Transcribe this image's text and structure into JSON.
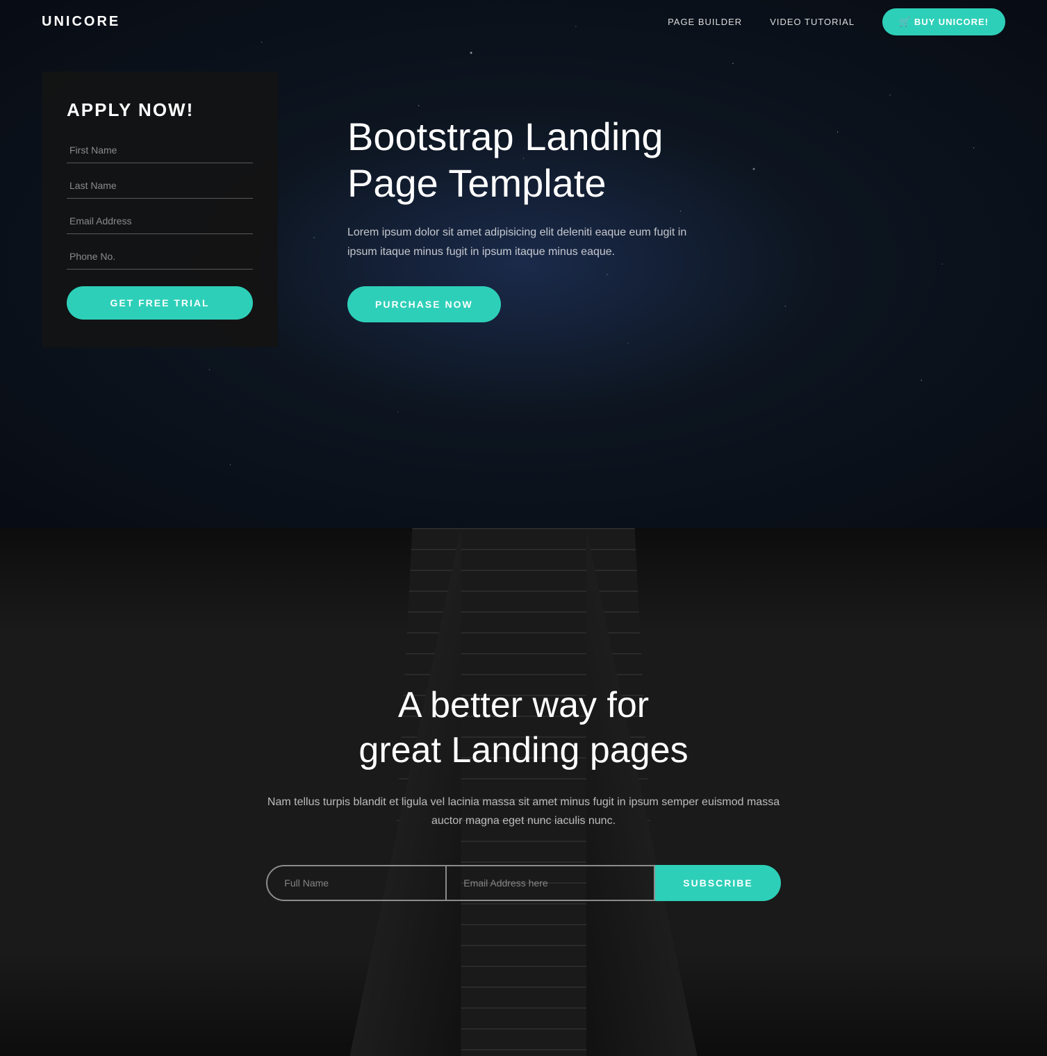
{
  "brand": {
    "name": "UNICORE"
  },
  "navbar": {
    "links": [
      {
        "label": "PAGE BUILDER",
        "id": "page-builder"
      },
      {
        "label": "VIDEO TUTORIAL",
        "id": "video-tutorial"
      }
    ],
    "cta": {
      "label": "BUY UNICORE!",
      "icon": "cart-icon"
    }
  },
  "apply_form": {
    "title": "APPLY NOW!",
    "fields": [
      {
        "placeholder": "First Name",
        "type": "text",
        "id": "first-name"
      },
      {
        "placeholder": "Last Name",
        "type": "text",
        "id": "last-name"
      },
      {
        "placeholder": "Email Address",
        "type": "email",
        "id": "email"
      },
      {
        "placeholder": "Phone No.",
        "type": "tel",
        "id": "phone"
      }
    ],
    "submit_label": "GET FREE TRIAL"
  },
  "hero": {
    "title": "Bootstrap Landing Page Template",
    "description": "Lorem ipsum dolor sit amet adipisicing elit deleniti eaque eum fugit in ipsum itaque minus fugit in ipsum itaque minus eaque.",
    "cta_label": "PURCHASE NOW"
  },
  "second_section": {
    "title": "A better way for\ngreat Landing pages",
    "description": "Nam tellus turpis blandit et ligula vel lacinia massa sit amet minus fugit in ipsum semper euismod massa auctor magna eget nunc iaculis nunc.",
    "subscribe": {
      "full_name_placeholder": "Full Name",
      "email_placeholder": "Email Address here",
      "button_label": "SUBSCRIBE"
    }
  },
  "colors": {
    "accent": "#2ecfb8",
    "dark_bg": "#1a1a1a",
    "card_bg": "rgba(20,20,20,0.92)"
  }
}
